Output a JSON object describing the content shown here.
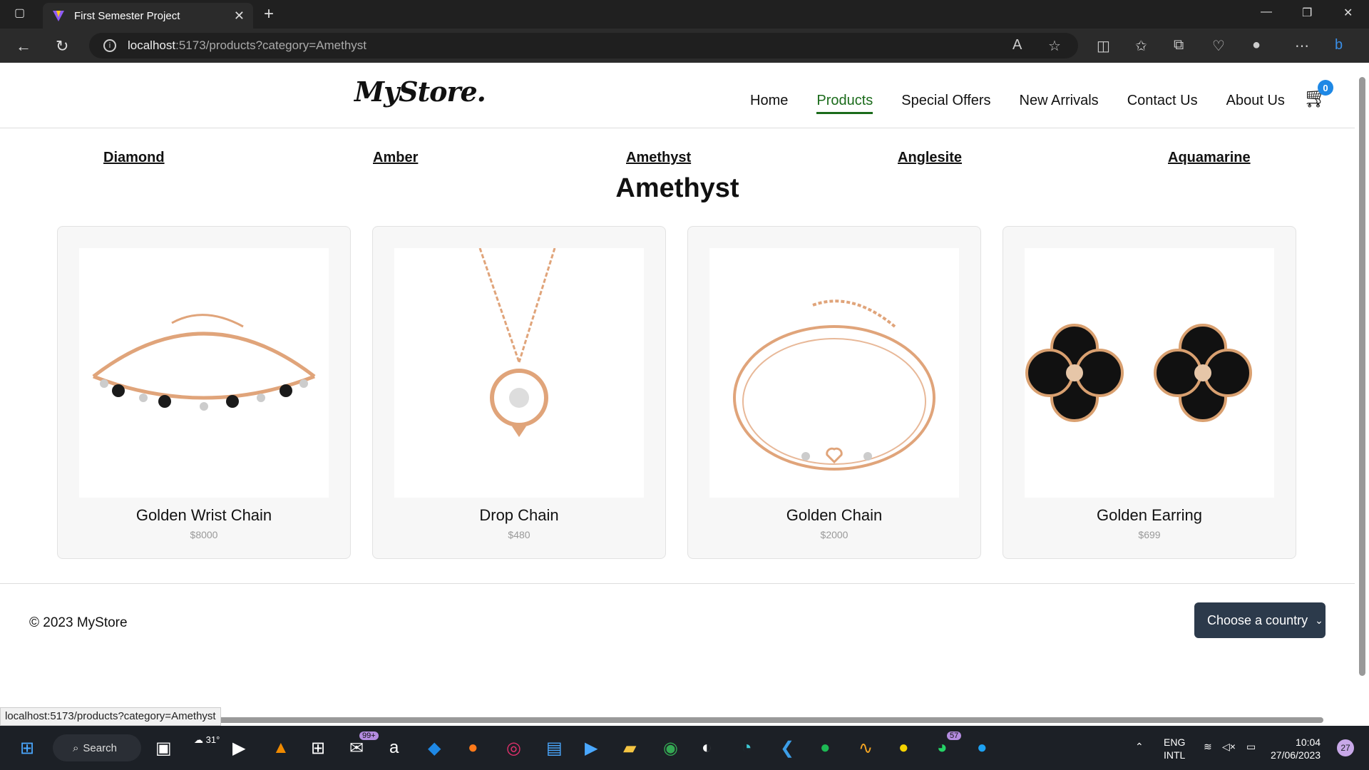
{
  "browser": {
    "tab_title": "First Semester Project",
    "url_host": "localhost",
    "url_rest": ":5173/products?category=Amethyst",
    "status_url": "localhost:5173/products?category=Amethyst"
  },
  "site": {
    "logo": "MyStore.",
    "menu": [
      "Home",
      "Products",
      "Special Offers",
      "New Arrivals",
      "Contact Us",
      "About Us"
    ],
    "active_menu": "Products",
    "cart_count": "0"
  },
  "categories": [
    "Diamond",
    "Amber",
    "Amethyst",
    "Anglesite",
    "Aquamarine"
  ],
  "category_title": "Amethyst",
  "products": [
    {
      "name": "Golden Wrist Chain",
      "price": "$8000"
    },
    {
      "name": "Drop Chain",
      "price": "$480"
    },
    {
      "name": "Golden Chain",
      "price": "$2000"
    },
    {
      "name": "Golden Earring",
      "price": "$699"
    }
  ],
  "footer": {
    "copyright": "© 2023 MyStore",
    "country_select": "Choose a country"
  },
  "taskbar": {
    "search_label": "Search",
    "weather": "31°",
    "mail_badge": "99+",
    "whatsapp_badge": "57",
    "lang1": "ENG",
    "lang2": "INTL",
    "time": "10:04",
    "date": "27/06/2023",
    "notifications": "27"
  }
}
